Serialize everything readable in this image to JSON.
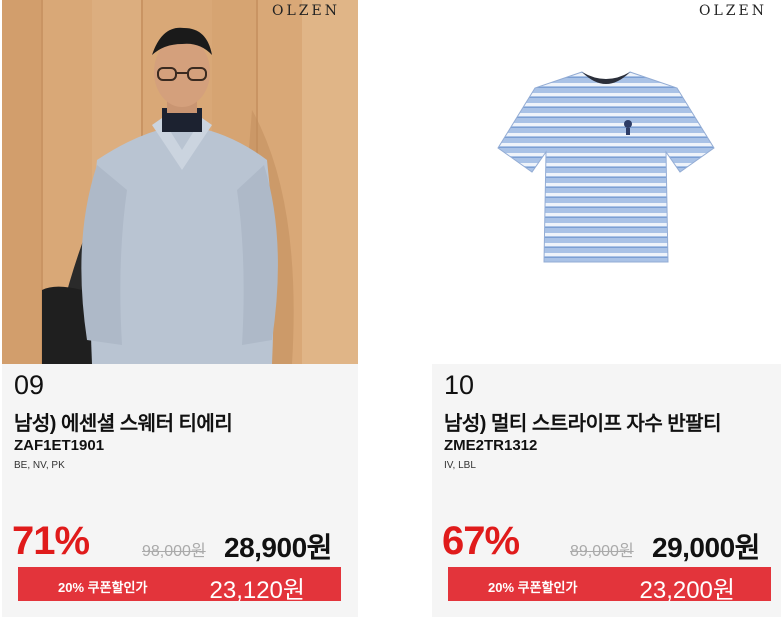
{
  "products": [
    {
      "brand": "OLZEN",
      "number": "09",
      "name": "남성) 에센셜 스웨터 티에리",
      "code": "ZAF1ET1901",
      "colors": "BE, NV, PK",
      "discount": "71%",
      "original_price": "98,000원",
      "sale_price": "28,900원",
      "coupon_label": "20% 쿠폰할인가",
      "coupon_price": "23,120원"
    },
    {
      "brand": "OLZEN",
      "number": "10",
      "name": "남성) 멀티 스트라이프 자수 반팔티",
      "code": "ZME2TR1312",
      "colors": "IV, LBL",
      "discount": "67%",
      "original_price": "89,000원",
      "sale_price": "29,000원",
      "coupon_label": "20% 쿠폰할인가",
      "coupon_price": "23,200원"
    }
  ],
  "colors": {
    "discount": "#e01b1b",
    "coupon_bg": "#e3343b",
    "card_bg": "#f5f5f5",
    "strike_price": "#aaaaaa"
  }
}
